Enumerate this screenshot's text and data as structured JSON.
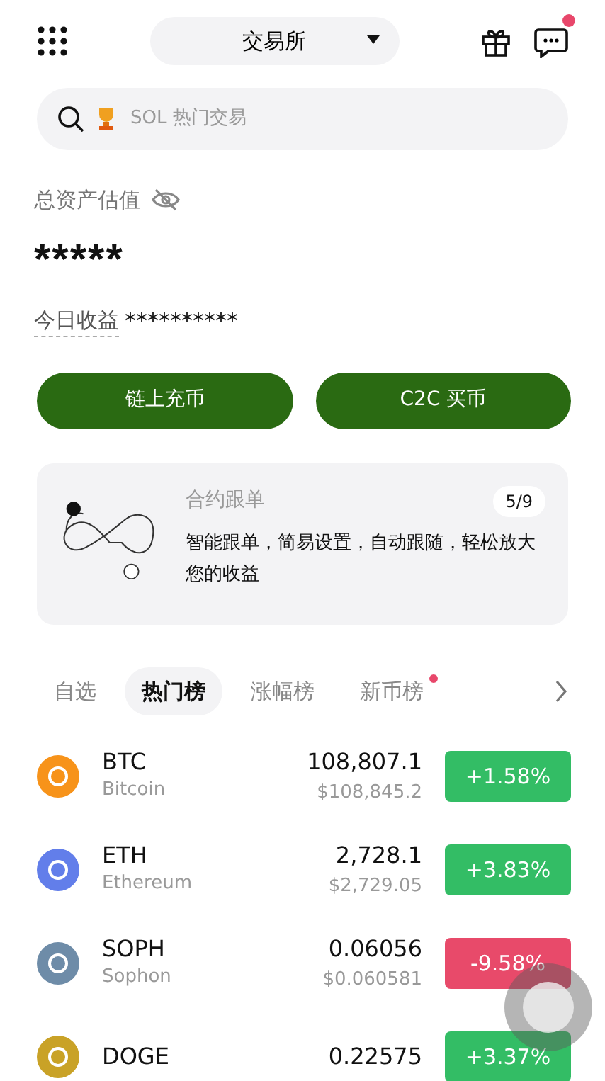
{
  "header": {
    "exchange": "交易所",
    "has_notification": true
  },
  "search": {
    "placeholder": "SOL 热门交易"
  },
  "assets": {
    "label": "总资产估值",
    "value": "*****",
    "today_label": "今日收益",
    "today_value": "**********"
  },
  "actions": [
    "链上充币",
    "C2C 买币"
  ],
  "promo": {
    "title": "合约跟单",
    "text": "智能跟单，简易设置，自动跟随，轻松放大您的收益",
    "counter": "5/9"
  },
  "tabs": [
    {
      "label": "自选",
      "selected": false,
      "dot": false
    },
    {
      "label": "热门榜",
      "selected": true,
      "dot": false
    },
    {
      "label": "涨幅榜",
      "selected": false,
      "dot": false
    },
    {
      "label": "新币榜",
      "selected": false,
      "dot": true
    }
  ],
  "coins": [
    {
      "symbol": "BTC",
      "name": "Bitcoin",
      "price": "108,807.1",
      "usd": "$108,845.2",
      "change": "+1.58%",
      "color": "#f7931a"
    },
    {
      "symbol": "ETH",
      "name": "Ethereum",
      "price": "2,728.1",
      "usd": "$2,729.05",
      "change": "+3.83%",
      "color": "#627eea"
    },
    {
      "symbol": "SOPH",
      "name": "Sophon",
      "price": "0.06056",
      "usd": "$0.060581",
      "change": "-9.58%",
      "color": "#6e8ca8"
    },
    {
      "symbol": "DOGE",
      "price": "0.22575",
      "change": "+3.37%",
      "color": "#c9a227"
    }
  ]
}
